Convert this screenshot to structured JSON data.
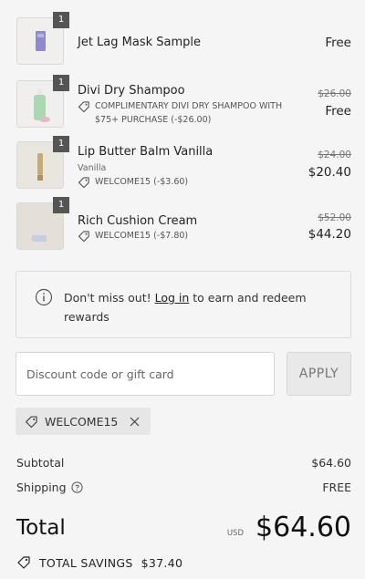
{
  "items": [
    {
      "name": "Jet Lag Mask Sample",
      "quantity": "1",
      "variant": "",
      "discount": "",
      "original_price": "",
      "price": "Free"
    },
    {
      "name": "Divi Dry Shampoo",
      "quantity": "1",
      "variant": "",
      "discount": "COMPLIMENTARY DIVI DRY SHAMPOO WITH $75+ PURCHASE (-$26.00)",
      "original_price": "$26.00",
      "price": "Free"
    },
    {
      "name": "Lip Butter Balm Vanilla",
      "quantity": "1",
      "variant": "Vanilla",
      "discount": "WELCOME15 (-$3.60)",
      "original_price": "$24.00",
      "price": "$20.40"
    },
    {
      "name": "Rich Cushion Cream",
      "quantity": "1",
      "variant": "",
      "discount": "WELCOME15 (-$7.80)",
      "original_price": "$52.00",
      "price": "$44.20"
    }
  ],
  "notice": {
    "prefix": "Don't miss out! ",
    "link": "Log in",
    "suffix": " to earn and redeem rewards"
  },
  "discount_form": {
    "placeholder": "Discount code or gift card",
    "value": "",
    "apply_label": "APPLY"
  },
  "applied_code": "WELCOME15",
  "summary": {
    "subtotal_label": "Subtotal",
    "subtotal_value": "$64.60",
    "shipping_label": "Shipping",
    "shipping_value": "FREE",
    "total_label": "Total",
    "currency": "USD",
    "total_value": "$64.60",
    "savings_label": "TOTAL SAVINGS",
    "savings_value": "$37.40"
  },
  "icons": {
    "tag": "tag-icon",
    "info": "info-icon",
    "help": "help-circle-icon",
    "remove": "close-icon",
    "savings": "price-tag-icon"
  },
  "colors": {
    "background": "#f5f5f5",
    "quantity_badge": "#555555",
    "apply_button": "#e9e9e9",
    "chip": "#e6e6e6"
  }
}
